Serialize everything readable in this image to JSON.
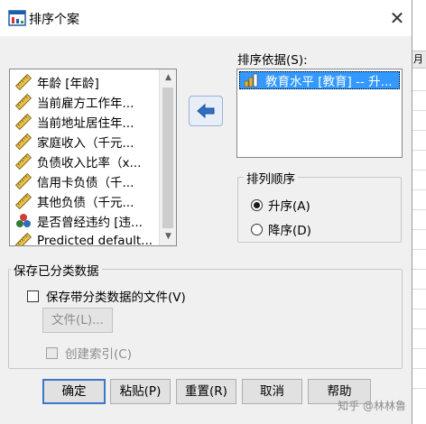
{
  "window": {
    "title": "排序个案",
    "close_label": "✕"
  },
  "variables": {
    "items": [
      {
        "label": "年龄 [年龄]",
        "icon": "ruler-icon"
      },
      {
        "label": "当前雇方工作年...",
        "icon": "ruler-icon"
      },
      {
        "label": "当前地址居住年...",
        "icon": "ruler-icon"
      },
      {
        "label": "家庭收入（千元...",
        "icon": "ruler-icon"
      },
      {
        "label": "负债收入比率（x...",
        "icon": "ruler-icon"
      },
      {
        "label": "信用卡负债（千...",
        "icon": "ruler-icon"
      },
      {
        "label": "其他负债（千元...",
        "icon": "ruler-icon"
      },
      {
        "label": "是否曾经违约 [违...",
        "icon": "nominal-circles-icon"
      },
      {
        "label": "Predicted default...",
        "icon": "ruler-icon"
      }
    ]
  },
  "sort_by": {
    "label": "排序依据(S):",
    "items": [
      {
        "label": "教育水平 [教育] -- 升...",
        "icon": "ordinal-bars-icon"
      }
    ]
  },
  "sort_order": {
    "legend": "排列顺序",
    "ascending": "升序(A)",
    "descending": "降序(D)",
    "selected": "ascending"
  },
  "save_group": {
    "legend": "保存已分类数据",
    "save_file_label": "保存带分类数据的文件(V)",
    "save_file_checked": false,
    "file_button": "文件(L)...",
    "create_index_label": "创建索引(C)",
    "create_index_checked": false
  },
  "buttons": {
    "ok": "确定",
    "paste": "粘贴(P)",
    "reset": "重置(R)",
    "cancel": "取消",
    "help": "帮助"
  },
  "background": {
    "sheet_header_fragment": "月"
  },
  "watermark": "知乎 @林林鲁",
  "colors": {
    "selection": "#3399ff",
    "dialog_bg": "#f0f0f0",
    "default_button_border": "#3b77c8"
  }
}
